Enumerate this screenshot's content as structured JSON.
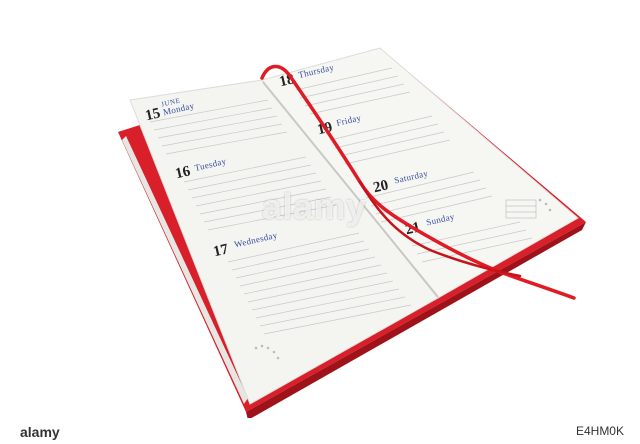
{
  "diary": {
    "month": "JUNE",
    "days": [
      {
        "num": "15",
        "name": "Monday"
      },
      {
        "num": "16",
        "name": "Tuesday"
      },
      {
        "num": "17",
        "name": "Wednesday"
      },
      {
        "num": "18",
        "name": "Thursday"
      },
      {
        "num": "19",
        "name": "Friday"
      },
      {
        "num": "20",
        "name": "Saturday"
      },
      {
        "num": "21",
        "name": "Sunday"
      }
    ]
  },
  "watermark": {
    "text": "alamy"
  },
  "footer": {
    "brand": "alamy",
    "image_id": "E4HM0K"
  },
  "colors": {
    "cover": "#d91f2a",
    "ribbon": "#e01b24",
    "page": "#f4f4f1",
    "day_name": "#3a4f9e"
  }
}
